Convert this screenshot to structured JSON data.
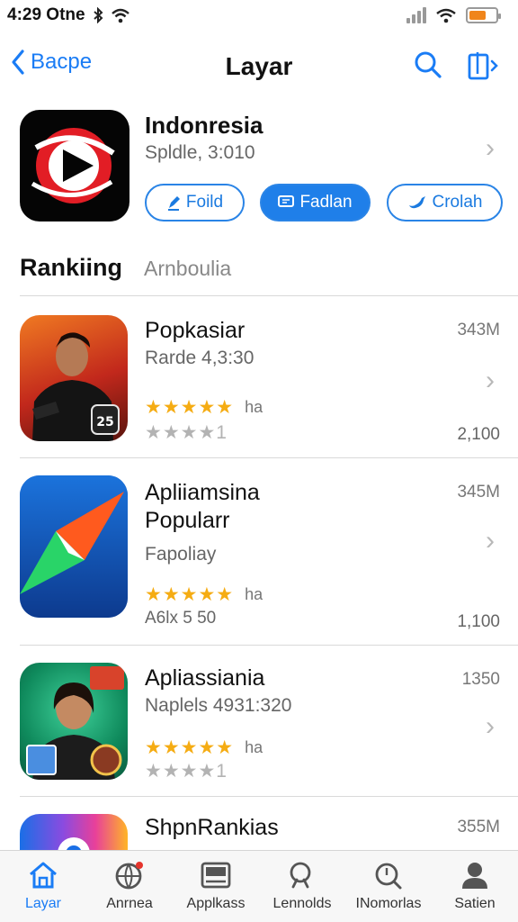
{
  "status_bar": {
    "time": "4:29 Otne",
    "battery_level": 0.65
  },
  "nav": {
    "back_label": "Bacpe",
    "title": "Layar"
  },
  "featured": {
    "name": "Indonresia",
    "subtitle": "Spldle, 3:010",
    "buttons": [
      {
        "label": "Foild",
        "icon": "pencil-icon"
      },
      {
        "label": "Fadlan",
        "icon": "chat-icon"
      },
      {
        "label": "Crolah",
        "icon": "bird-icon"
      }
    ]
  },
  "section": {
    "title": "Rankiing",
    "tab": "Arnboulia"
  },
  "apps": [
    {
      "name": "Popkasiar",
      "subtitle": "Rarde 4,3:30",
      "size": "343M",
      "stars_label": "ha",
      "rating_line": "★★★★1",
      "extra": "2,100",
      "rating": 5
    },
    {
      "name": "Apliiamsina Popularr",
      "subtitle": "Fapoliay",
      "size": "345M",
      "stars_label": "ha",
      "rating_line": "A6lx 5 50",
      "extra": "1,100",
      "rating": 5
    },
    {
      "name": "Apliassiania",
      "subtitle": "Naplels 4931:320",
      "size": "1350",
      "stars_label": "ha",
      "rating_line": "★★★★1",
      "extra": "",
      "rating": 5
    },
    {
      "name": "ShpnRankias",
      "subtitle": "",
      "size": "355M",
      "stars_label": "",
      "rating_line": "",
      "extra": "",
      "rating": 0
    }
  ],
  "tabs": [
    {
      "label": "Layar",
      "icon": "home-icon",
      "active": true
    },
    {
      "label": "Anrnea",
      "icon": "globe-icon",
      "active": false
    },
    {
      "label": "Applkass",
      "icon": "apps-icon",
      "active": false
    },
    {
      "label": "Lennolds",
      "icon": "search-icon",
      "active": false
    },
    {
      "label": "INomorlas",
      "icon": "search-alt-icon",
      "active": false
    },
    {
      "label": "Satien",
      "icon": "profile-icon",
      "active": false
    }
  ],
  "colors": {
    "accent": "#1a7cf5",
    "star": "#f5ac13",
    "star_empty": "#b3b3b3"
  }
}
